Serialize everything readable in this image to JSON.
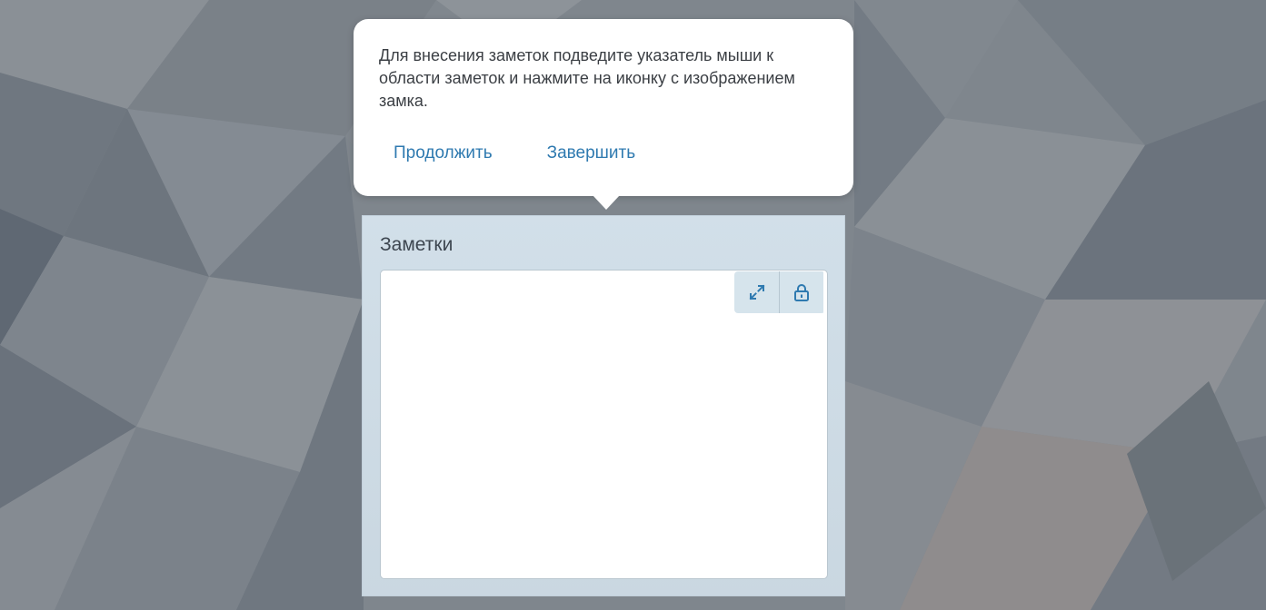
{
  "tooltip": {
    "message": "Для внесения заметок подведите указатель мыши к области заметок и нажмите на иконку с изображением замка.",
    "continue_label": "Продолжить",
    "finish_label": "Завершить"
  },
  "notes": {
    "title": "Заметки",
    "content": "",
    "toolbar": {
      "expand_icon": "expand-icon",
      "lock_icon": "lock-icon"
    }
  },
  "colors": {
    "accent": "#2f7ab0",
    "panel_bg": "#d6e4ee",
    "text": "#3b3f44"
  }
}
